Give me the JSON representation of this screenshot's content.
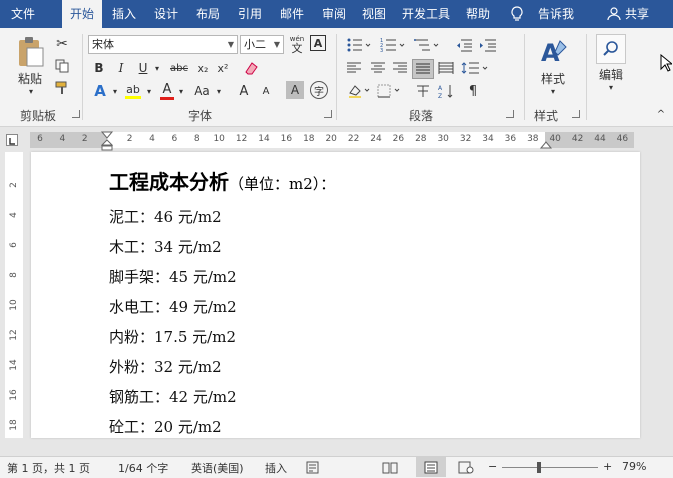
{
  "tabs": [
    "文件",
    "开始",
    "插入",
    "设计",
    "布局",
    "引用",
    "邮件",
    "审阅",
    "视图",
    "开发工具",
    "帮助"
  ],
  "tell_me": "告诉我",
  "share": "共享",
  "ribbon": {
    "clipboard": {
      "paste": "粘贴",
      "label": "剪贴板"
    },
    "font": {
      "name": "宋体",
      "size": "小二",
      "label": "字体",
      "wen": "wén",
      "wen_char": "文",
      "bold": "B",
      "italic": "I",
      "underline": "U",
      "strike": "abc",
      "sub": "x₂",
      "sup": "x²",
      "case": "Aa",
      "grow": "A",
      "shrink": "A",
      "clear": "A",
      "color_a": "A",
      "highlight": "ab",
      "border_char": "字"
    },
    "paragraph": {
      "label": "段落"
    },
    "styles": {
      "label": "样式",
      "button": "样式"
    },
    "editing": {
      "button": "编辑"
    }
  },
  "ruler": {
    "h_ticks": [
      "6",
      "4",
      "2",
      "2",
      "4",
      "6",
      "8",
      "10",
      "12",
      "14",
      "16",
      "18",
      "20",
      "22",
      "24",
      "26",
      "28",
      "30",
      "32",
      "34",
      "36",
      "38",
      "40",
      "42",
      "44",
      "46"
    ],
    "v_ticks": [
      "2",
      "4",
      "6",
      "8",
      "10",
      "12",
      "14",
      "16",
      "18"
    ]
  },
  "document": {
    "title": "工程成本分析",
    "title_suffix": "（单位：m2）：",
    "lines": [
      "泥工：46 元/m2",
      "木工：34 元/m2",
      "脚手架：45 元/m2",
      "水电工：49 元/m2",
      "内粉：17.5 元/m2",
      "外粉：32 元/m2",
      "钢筋工：42 元/m2",
      "砼工：20 元/m2"
    ]
  },
  "status": {
    "page": "第 1 页，共 1 页",
    "words": "1/64 个字",
    "language": "英语(美国)",
    "mode": "插入",
    "zoom": "79%",
    "zoom_level": 0.79
  },
  "colors": {
    "accent": "#2b579a",
    "font_color": "#e0201b",
    "highlight": "#ffff00"
  }
}
